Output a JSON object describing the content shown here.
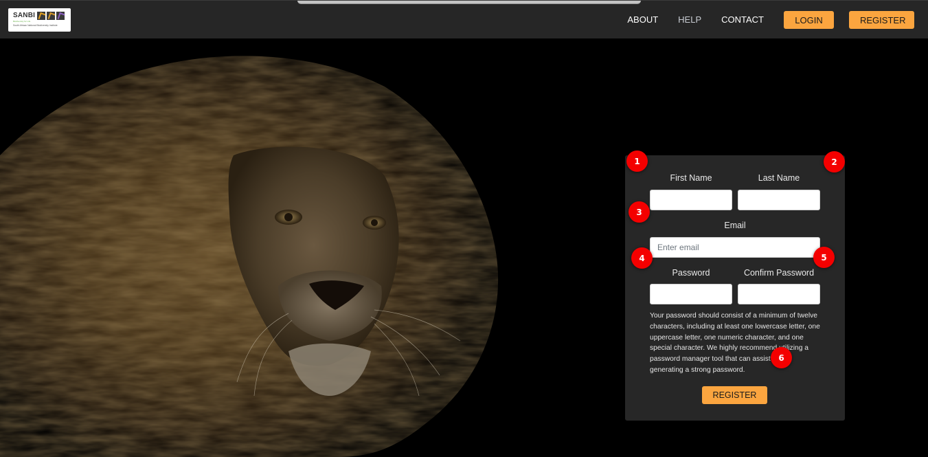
{
  "navbar": {
    "logo": {
      "brand": "SANBI",
      "tagline": "Biodiversity for Life",
      "full_name": "South African National Biodiversity Institute",
      "tile_colors": [
        "#e0a020",
        "#d69a2a",
        "#8b5fc2"
      ]
    },
    "links": [
      {
        "label": "ABOUT"
      },
      {
        "label": "HELP"
      },
      {
        "label": "CONTACT"
      }
    ],
    "login_label": "LOGIN",
    "register_label": "REGISTER"
  },
  "hero": {
    "image_subject": "lion portrait on black background"
  },
  "form": {
    "first_name": {
      "label": "First Name",
      "value": "",
      "placeholder": ""
    },
    "last_name": {
      "label": "Last Name",
      "value": "",
      "placeholder": ""
    },
    "email": {
      "label": "Email",
      "value": "",
      "placeholder": "Enter email"
    },
    "password": {
      "label": "Password",
      "value": "",
      "placeholder": ""
    },
    "confirm_password": {
      "label": "Confirm Password",
      "value": "",
      "placeholder": ""
    },
    "help_text": "Your password should consist of a minimum of twelve characters, including at least one lowercase letter, one uppercase letter, one numeric character, and one special character. We highly recommend utilizing a password manager tool that can assist you in generating a strong password.",
    "submit_label": "REGISTER"
  },
  "markers": [
    "1",
    "2",
    "3",
    "4",
    "5",
    "6"
  ],
  "colors": {
    "accent": "#fba53f",
    "navbar_bg": "#262626",
    "card_bg": "#272727",
    "marker": "#f40000"
  }
}
